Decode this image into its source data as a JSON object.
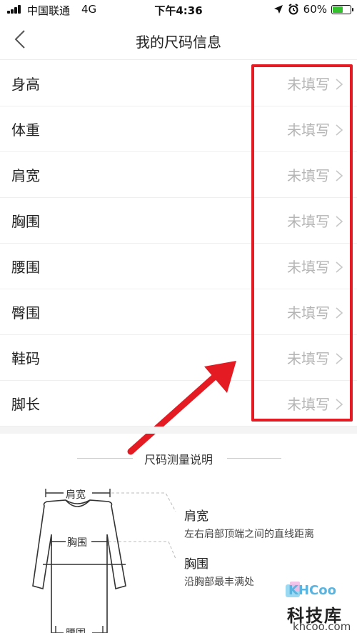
{
  "status_bar": {
    "carrier": "中国联通",
    "network": "4G",
    "time": "下午4:36",
    "battery": "60%",
    "battery_level": 0.6,
    "battery_color": "#35c22f"
  },
  "nav": {
    "title": "我的尺码信息",
    "back_icon": "chevron-left-icon"
  },
  "rows": [
    {
      "label": "身高",
      "value": "未填写"
    },
    {
      "label": "体重",
      "value": "未填写"
    },
    {
      "label": "肩宽",
      "value": "未填写"
    },
    {
      "label": "胸围",
      "value": "未填写"
    },
    {
      "label": "腰围",
      "value": "未填写"
    },
    {
      "label": "臀围",
      "value": "未填写"
    },
    {
      "label": "鞋码",
      "value": "未填写"
    },
    {
      "label": "脚长",
      "value": "未填写"
    }
  ],
  "annotation": {
    "color": "#e51b23"
  },
  "guide": {
    "title": "尺码测量说明",
    "diagram_labels": {
      "shoulder": "肩宽",
      "chest": "胸围",
      "waist": "腰围"
    },
    "items": [
      {
        "title": "肩宽",
        "text": "左右肩部顶端之间的直线距离"
      },
      {
        "title": "胸围",
        "text": "沿胸部最丰满处"
      }
    ]
  },
  "watermark": {
    "brand": "KHCoo",
    "name": "科技库",
    "url": "khcoo.com"
  }
}
